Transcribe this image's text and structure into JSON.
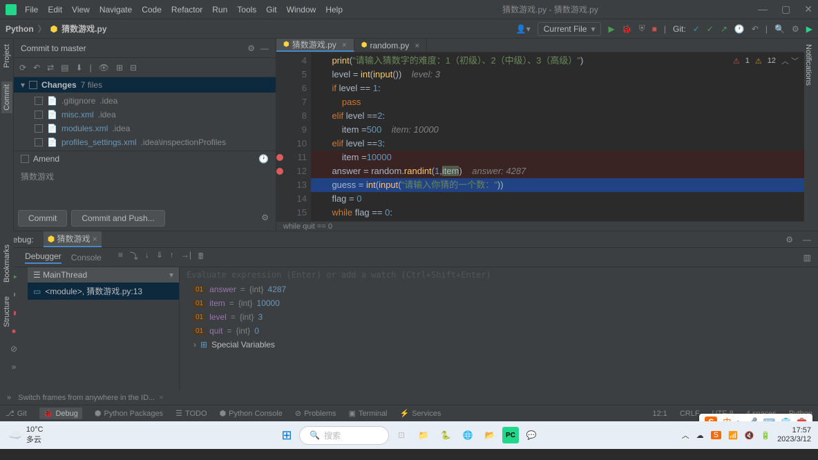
{
  "menu": {
    "file": "File",
    "edit": "Edit",
    "view": "View",
    "navigate": "Navigate",
    "code": "Code",
    "refactor": "Refactor",
    "run": "Run",
    "tools": "Tools",
    "git": "Git",
    "window": "Window",
    "help": "Help"
  },
  "title": "猜数游戏.py - 猜数游戏.py",
  "breadcrumb": {
    "project": "Python",
    "file": "猜数游戏.py"
  },
  "runconfig": "Current File",
  "git_label": "Git:",
  "commit": {
    "title": "Commit to master",
    "changes_label": "Changes",
    "changes_count": "7 files",
    "files": [
      {
        "name": ".gitignore",
        "dir": ".idea"
      },
      {
        "name": "misc.xml",
        "dir": ".idea"
      },
      {
        "name": "modules.xml",
        "dir": ".idea"
      },
      {
        "name": "profiles_settings.xml",
        "dir": ".idea\\inspectionProfiles"
      }
    ],
    "amend": "Amend",
    "message": "猜数游戏",
    "btn_commit": "Commit",
    "btn_push": "Commit and Push..."
  },
  "tabs": [
    {
      "name": "猜数游戏.py",
      "active": true
    },
    {
      "name": "random.py",
      "active": false
    }
  ],
  "gutter": [
    "4",
    "5",
    "6",
    "7",
    "8",
    "9",
    "10",
    "11",
    "12",
    "13",
    "14",
    "15"
  ],
  "breakpoints": [
    "11",
    "12"
  ],
  "code_crumb": "while quit == 0",
  "warnings": {
    "errors": "1",
    "warns": "12"
  },
  "debug": {
    "label": "Debug:",
    "session": "猜数游戏",
    "tab_debugger": "Debugger",
    "tab_console": "Console",
    "thread": "MainThread",
    "frame": "<module>, 猜数游戏.py:13",
    "expr_placeholder": "Evaluate expression (Enter) or add a watch (Ctrl+Shift+Enter)",
    "vars": [
      {
        "name": "answer",
        "type": "{int}",
        "value": "4287"
      },
      {
        "name": "item",
        "type": "{int}",
        "value": "10000"
      },
      {
        "name": "level",
        "type": "{int}",
        "value": "3"
      },
      {
        "name": "quit",
        "type": "{int}",
        "value": "0"
      }
    ],
    "special": "Special Variables"
  },
  "left_tabs": {
    "project": "Project",
    "commit": "Commit",
    "bookmarks": "Bookmarks",
    "structure": "Structure"
  },
  "right_tab": "Notifications",
  "tip": "Switch frames from anywhere in the ID...",
  "status": {
    "git": "Git",
    "debug": "Debug",
    "pkg": "Python Packages",
    "todo": "TODO",
    "console": "Python Console",
    "problems": "Problems",
    "terminal": "Terminal",
    "services": "Services",
    "pos": "12:1",
    "sep": "CRLF",
    "enc": "UTF-8",
    "indent": "4 spaces",
    "interp": "Python"
  },
  "taskbar": {
    "temp": "10°C",
    "weather": "多云",
    "search": "搜索",
    "time": "17:57",
    "date": "2023/3/12"
  },
  "ime": {
    "logo": "S",
    "zhong": "中"
  },
  "code_hints": {
    "level": "level: 3",
    "item": "item: 10000",
    "answer": "answer: 4287"
  }
}
